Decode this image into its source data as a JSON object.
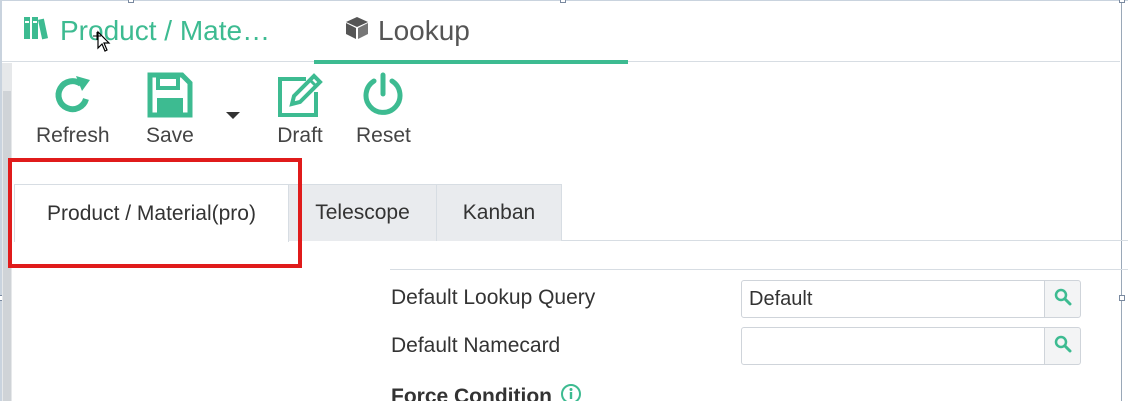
{
  "header": {
    "tabs": [
      {
        "label": "Product / Mate…",
        "icon": "books-icon",
        "active": false
      },
      {
        "label": "Lookup",
        "icon": "cube-icon",
        "active": true
      }
    ]
  },
  "toolbar": {
    "refresh_label": "Refresh",
    "save_label": "Save",
    "draft_label": "Draft",
    "reset_label": "Reset"
  },
  "subtabs": [
    {
      "label": "Product / Material(pro)",
      "active": true
    },
    {
      "label": "Telescope",
      "active": false
    },
    {
      "label": "Kanban",
      "active": false
    }
  ],
  "form": {
    "default_lookup_query": {
      "label": "Default Lookup Query",
      "value": "Default"
    },
    "default_namecard": {
      "label": "Default Namecard",
      "value": ""
    },
    "force_condition_label": "Force Condition"
  },
  "colors": {
    "accent": "#3dbb91",
    "highlight": "#e01b1b"
  }
}
